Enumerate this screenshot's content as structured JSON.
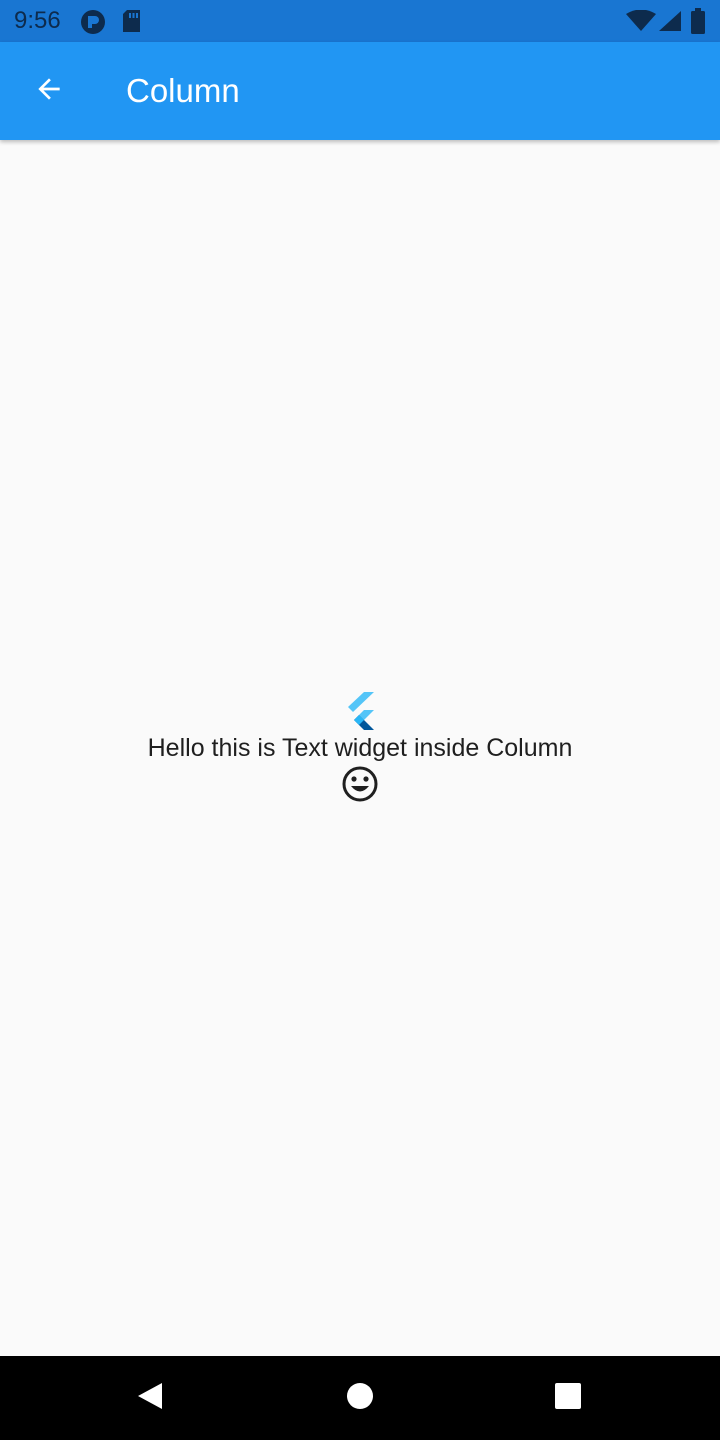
{
  "status_bar": {
    "time": "9:56",
    "icons": [
      "app-notification-icon",
      "sd-card-icon",
      "wifi-icon",
      "signal-icon",
      "battery-icon"
    ],
    "background": "#1976d2"
  },
  "app_bar": {
    "title": "Column",
    "back_icon": "arrow-back-icon",
    "background": "#2196f3"
  },
  "content": {
    "logo_icon": "flutter-logo-icon",
    "text": "Hello this is Text widget inside Column",
    "emoji_icon": "smile-icon"
  },
  "nav_bar": {
    "buttons": [
      "back-triangle-icon",
      "home-circle-icon",
      "recents-square-icon"
    ]
  }
}
